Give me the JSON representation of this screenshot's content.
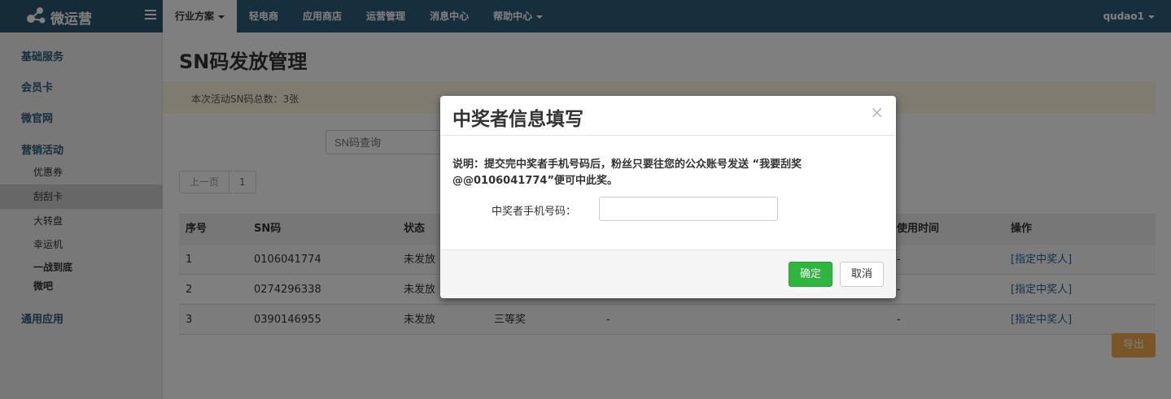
{
  "brand": {
    "name": "微运营"
  },
  "nav": {
    "items": [
      {
        "label": "行业方案",
        "has_caret": true,
        "active": true
      },
      {
        "label": "轻电商"
      },
      {
        "label": "应用商店"
      },
      {
        "label": "运营管理"
      },
      {
        "label": "消息中心"
      },
      {
        "label": "帮助中心",
        "has_caret": true
      }
    ],
    "user": "qudao1"
  },
  "sidebar": {
    "groups": [
      "基础服务",
      "会员卡",
      "微官网",
      "营销活动",
      "通用应用"
    ],
    "items": [
      "优惠券",
      "刮刮卡",
      "大转盘",
      "幸运机"
    ],
    "active_item": "刮刮卡",
    "extra": [
      "一战到底",
      "微吧"
    ]
  },
  "main": {
    "title": "SN码发放管理",
    "total_text": "本次活动SN码总数：3张",
    "search_placeholder": "SN码查询",
    "pager": {
      "prev": "上一页",
      "current": "1"
    },
    "table": {
      "headers": {
        "index": "序号",
        "sn": "SN码",
        "status": "状态",
        "used_time": "使用时间",
        "action": "操作"
      },
      "rows": [
        {
          "index": "1",
          "sn": "0106041774",
          "status": "未发放",
          "prize": "",
          "winner": "",
          "used_time": "-",
          "action": "[指定中奖人]"
        },
        {
          "index": "2",
          "sn": "0274296338",
          "status": "未发放",
          "prize": "",
          "winner": "",
          "used_time": "-",
          "action": "[指定中奖人]"
        },
        {
          "index": "3",
          "sn": "0390146955",
          "status": "未发放",
          "prize": "三等奖",
          "winner": "-",
          "used_time": "-",
          "action": "[指定中奖人]"
        }
      ]
    },
    "export_label": "导出"
  },
  "modal": {
    "title": "中奖者信息填写",
    "close": "×",
    "description_line1": "说明：提交完中奖者手机号码后，粉丝只要往您的公众账号发送 “我要刮奖",
    "description_line2": "@@0106041774”便可中此奖。",
    "phone_label": "中奖者手机号码：",
    "phone_value": "",
    "ok_label": "确定",
    "cancel_label": "取消"
  },
  "colors": {
    "topbar": "#2f5f7a",
    "accent_green": "#2fb63f",
    "accent_orange": "#f0ad4e",
    "link": "#2a6496"
  }
}
